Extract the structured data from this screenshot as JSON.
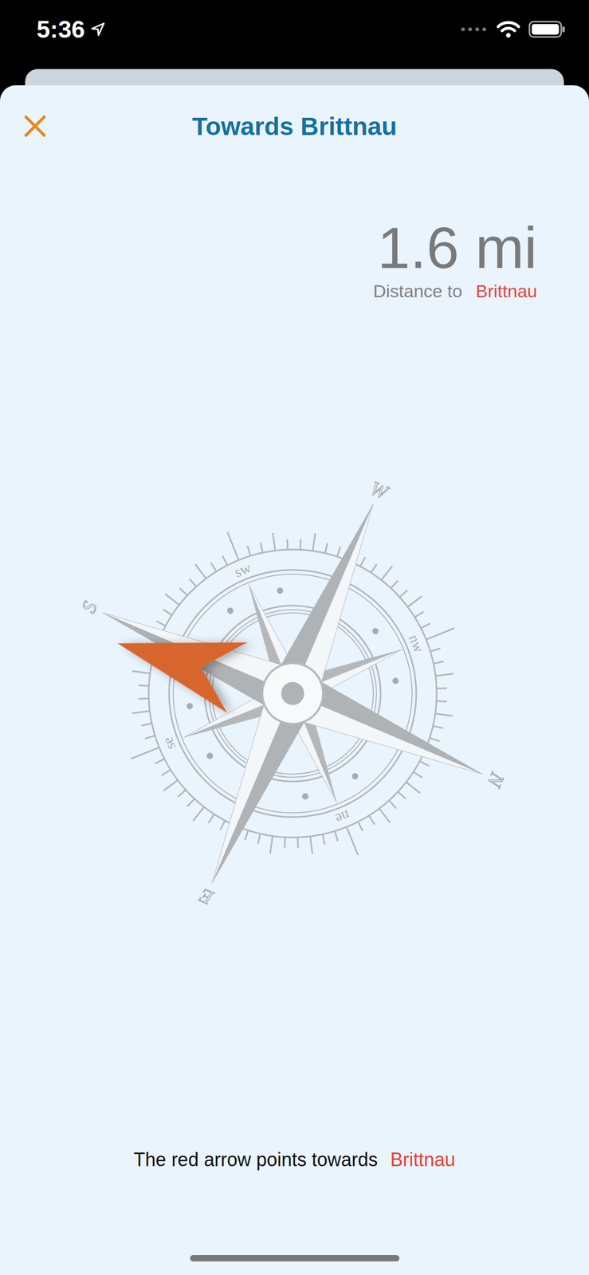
{
  "status_bar": {
    "time": "5:36"
  },
  "title": "Towards Brittnau",
  "distance": {
    "value": "1.6 mi",
    "label": "Distance to",
    "destination": "Brittnau"
  },
  "compass": {
    "rotation_deg": 113,
    "target_bearing_deg": 173,
    "cardinals": [
      "N",
      "E",
      "S",
      "W"
    ],
    "intercardinals": [
      "ne",
      "se",
      "sw",
      "nw"
    ]
  },
  "footer": {
    "text": "The red arrow points towards",
    "destination": "Brittnau"
  }
}
